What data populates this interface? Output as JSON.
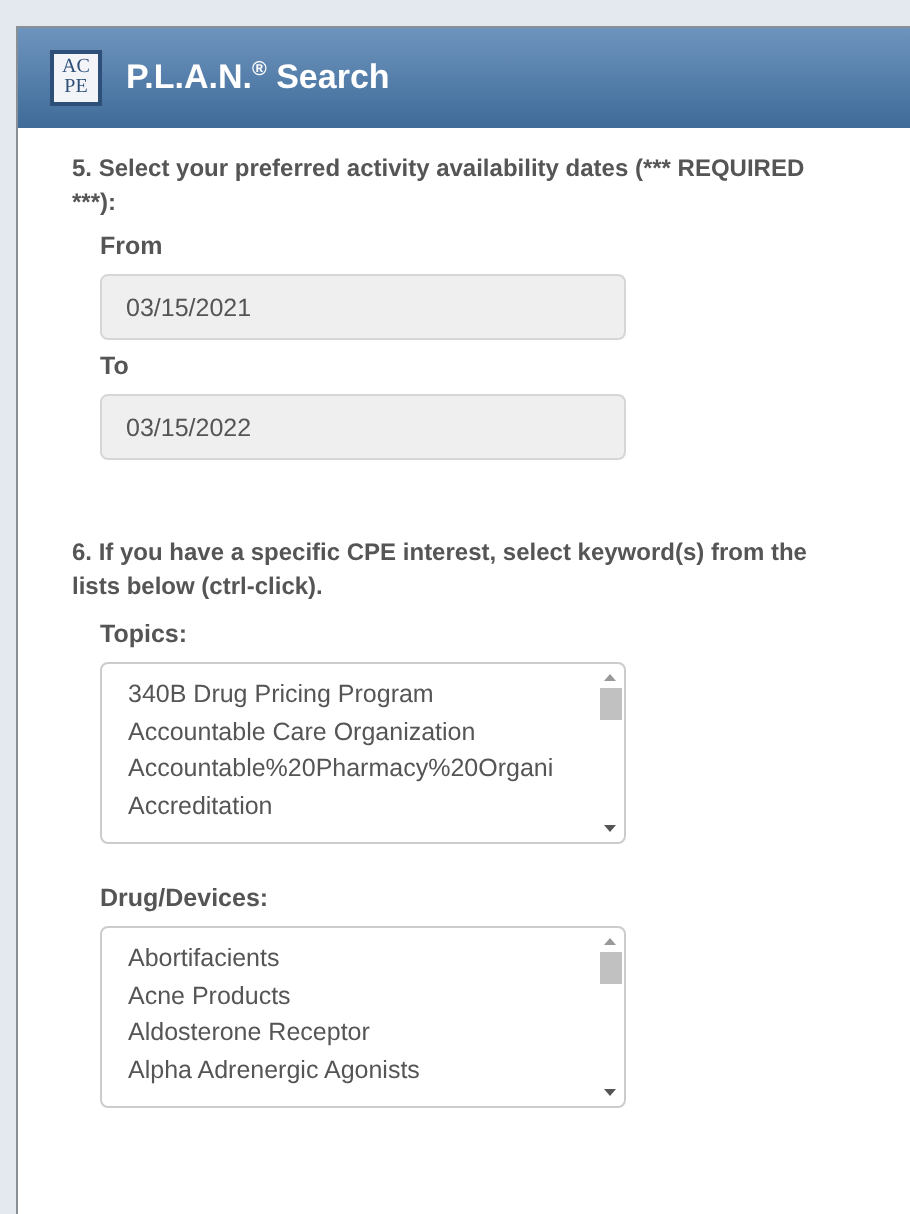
{
  "header": {
    "logo_lines": [
      "AC",
      "PE"
    ],
    "title": "P.L.A.N.",
    "title_mark": "®",
    "title_rest": "Search"
  },
  "dates": {
    "heading": "5. Select your preferred activity availability dates (*** REQUIRED ***):",
    "fields": [
      {
        "label": "From",
        "value": "03/15/2021"
      },
      {
        "label": "To",
        "value": "03/15/2022"
      }
    ]
  },
  "keywords": {
    "heading": "6. If you have a specific CPE interest, select keyword(s) from the lists below (ctrl-click).",
    "lists": [
      {
        "label": "Topics:",
        "items": [
          "340B Drug Pricing Program",
          "Accountable Care Organization",
          "Accountable%20Pharmacy%20Organi",
          "Accreditation"
        ]
      },
      {
        "label": "Drug/Devices:",
        "items": [
          "Abortifacients",
          "Acne Products",
          "Aldosterone Receptor",
          "Alpha Adrenergic Agonists"
        ]
      }
    ]
  }
}
